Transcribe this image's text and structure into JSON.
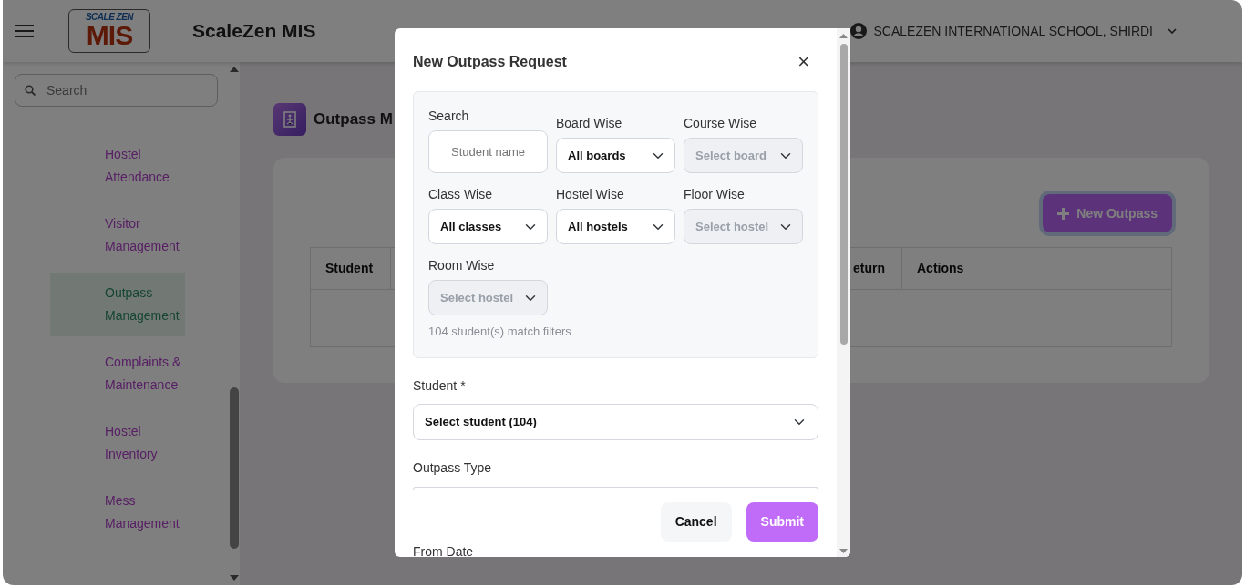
{
  "header": {
    "logo": {
      "tagline": "SCALE ZEN",
      "wordmark": "MIS"
    },
    "title": "ScaleZen MIS",
    "account": "SCALEZEN INTERNATIONAL SCHOOL, SHIRDI"
  },
  "sidebar": {
    "search": {
      "placeholder": "Search"
    },
    "items": [
      {
        "label": "Hostel Attendance",
        "selected": false
      },
      {
        "label": "Visitor Management",
        "selected": false
      },
      {
        "label": "Outpass Management",
        "selected": true
      },
      {
        "label": "Complaints & Maintenance",
        "selected": false
      },
      {
        "label": "Hostel Inventory",
        "selected": false
      },
      {
        "label": "Mess Management",
        "selected": false
      }
    ]
  },
  "main": {
    "page_title": "Outpass M",
    "new_button": "New Outpass",
    "table": {
      "columns": [
        {
          "label": "Student"
        },
        {
          "label": "eturn"
        },
        {
          "label": "Actions"
        }
      ]
    }
  },
  "modal": {
    "title": "New Outpass Request",
    "close": "×",
    "filters": [
      {
        "label": "Search",
        "kind": "text",
        "placeholder": "Student name",
        "disabled": false
      },
      {
        "label": "Board Wise",
        "kind": "select",
        "value": "All boards",
        "disabled": false
      },
      {
        "label": "Course Wise",
        "kind": "select",
        "value": "Select board",
        "disabled": true
      },
      {
        "label": "Class Wise",
        "kind": "select",
        "value": "All classes",
        "disabled": false
      },
      {
        "label": "Hostel Wise",
        "kind": "select",
        "value": "All hostels",
        "disabled": false
      },
      {
        "label": "Floor Wise",
        "kind": "select",
        "value": "Select hostel",
        "disabled": true
      },
      {
        "label": "Room Wise",
        "kind": "select",
        "value": "Select hostel",
        "disabled": true
      }
    ],
    "match_count": "104 student(s) match filters",
    "student": {
      "label": "Student *",
      "value": "Select student (104)"
    },
    "outpass_type": {
      "label": "Outpass Type"
    },
    "buttons": [
      {
        "label": "Cancel",
        "kind": "secondary"
      },
      {
        "label": "Submit",
        "kind": "primary"
      }
    ],
    "from_date": {
      "label": "From Date"
    }
  }
}
